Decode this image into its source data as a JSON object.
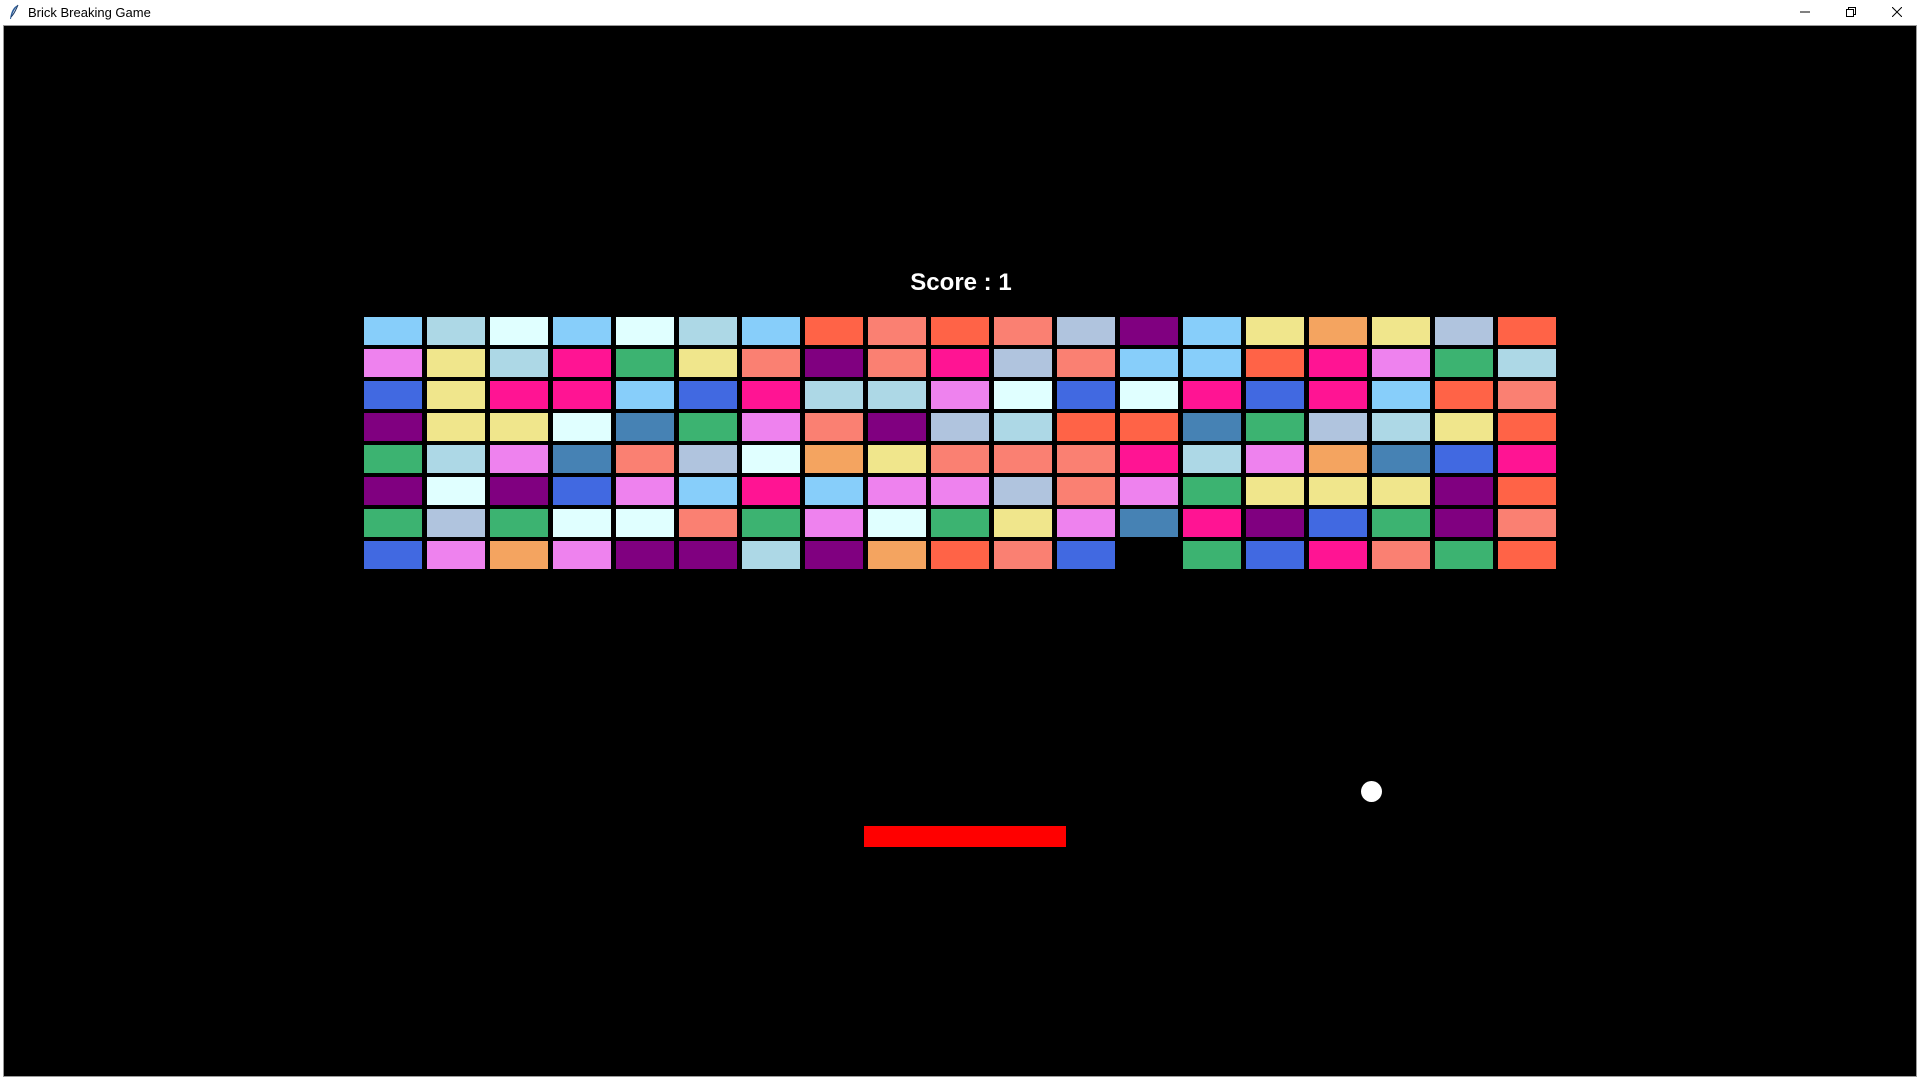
{
  "window": {
    "title": "Brick Breaking Game",
    "icons": {
      "app": "feather-icon",
      "minimize": "minimize-icon",
      "restore": "restore-icon",
      "close": "close-icon"
    }
  },
  "game": {
    "score_text": "Score : 1",
    "background": "#000000",
    "paddle_color": "#ff0000",
    "ball_color": "#ffffff",
    "bricks": [
      [
        "#87cefa",
        "#add8e6",
        "#e0ffff",
        "#87cefa",
        "#e0ffff",
        "#add8e6",
        "#87cefa",
        "#ff6347",
        "#fa8072",
        "#ff6347",
        "#fa8072",
        "#b0c4de",
        "#800080",
        "#87cefa",
        "#f0e68c",
        "#f4a460",
        "#f0e68c",
        "#b0c4de",
        "#ff6347"
      ],
      [
        "#ee82ee",
        "#f0e68c",
        "#add8e6",
        "#ff1493",
        "#3cb371",
        "#f0e68c",
        "#fa8072",
        "#800080",
        "#fa8072",
        "#ff1493",
        "#b0c4de",
        "#fa8072",
        "#87cefa",
        "#87cefa",
        "#ff6347",
        "#ff1493",
        "#ee82ee",
        "#3cb371",
        "#add8e6"
      ],
      [
        "#4169e1",
        "#f0e68c",
        "#ff1493",
        "#ff1493",
        "#87cefa",
        "#4169e1",
        "#ff1493",
        "#add8e6",
        "#add8e6",
        "#ee82ee",
        "#e0ffff",
        "#4169e1",
        "#e0ffff",
        "#ff1493",
        "#4169e1",
        "#ff1493",
        "#87cefa",
        "#ff6347",
        "#fa8072"
      ],
      [
        "#800080",
        "#f0e68c",
        "#f0e68c",
        "#e0ffff",
        "#4682b4",
        "#3cb371",
        "#ee82ee",
        "#fa8072",
        "#800080",
        "#b0c4de",
        "#add8e6",
        "#ff6347",
        "#ff6347",
        "#4682b4",
        "#3cb371",
        "#b0c4de",
        "#add8e6",
        "#f0e68c",
        "#ff6347"
      ],
      [
        "#3cb371",
        "#add8e6",
        "#ee82ee",
        "#4682b4",
        "#fa8072",
        "#b0c4de",
        "#e0ffff",
        "#f4a460",
        "#f0e68c",
        "#fa8072",
        "#fa8072",
        "#fa8072",
        "#ff1493",
        "#add8e6",
        "#ee82ee",
        "#f4a460",
        "#4682b4",
        "#4169e1",
        "#ff1493"
      ],
      [
        "#800080",
        "#e0ffff",
        "#800080",
        "#4169e1",
        "#ee82ee",
        "#87cefa",
        "#ff1493",
        "#87cefa",
        "#ee82ee",
        "#ee82ee",
        "#b0c4de",
        "#fa8072",
        "#ee82ee",
        "#3cb371",
        "#f0e68c",
        "#f0e68c",
        "#f0e68c",
        "#800080",
        "#ff6347"
      ],
      [
        "#3cb371",
        "#b0c4de",
        "#3cb371",
        "#e0ffff",
        "#e0ffff",
        "#fa8072",
        "#3cb371",
        "#ee82ee",
        "#e0ffff",
        "#3cb371",
        "#f0e68c",
        "#ee82ee",
        "#4682b4",
        "#ff1493",
        "#800080",
        "#4169e1",
        "#3cb371",
        "#800080",
        "#fa8072"
      ],
      [
        "#4169e1",
        "#ee82ee",
        "#f4a460",
        "#ee82ee",
        "#800080",
        "#800080",
        "#add8e6",
        "#800080",
        "#f4a460",
        "#ff6347",
        "#fa8072",
        "#4169e1",
        null,
        "#3cb371",
        "#4169e1",
        "#ff1493",
        "#fa8072",
        "#3cb371",
        "#ff6347"
      ]
    ]
  }
}
